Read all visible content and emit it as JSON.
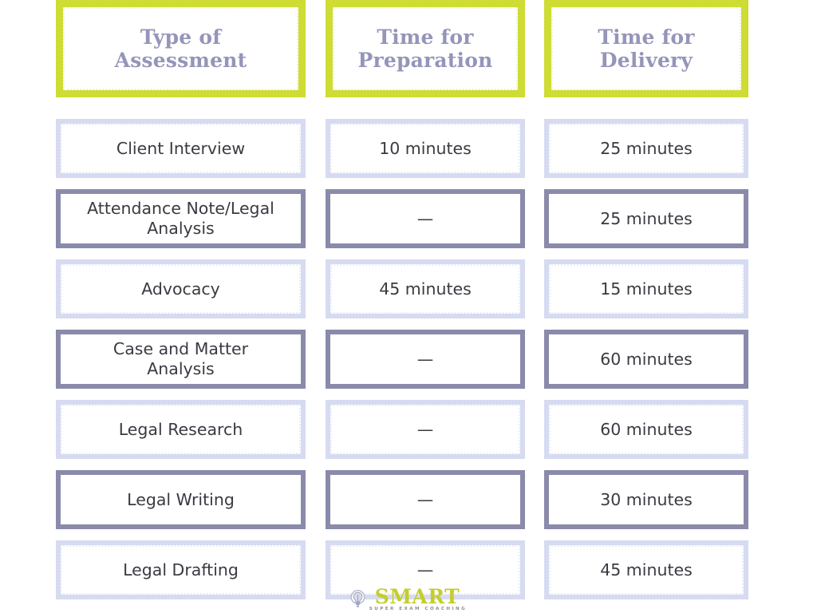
{
  "colors": {
    "header_border": "#cedc34",
    "header_text": "#9595ba",
    "row_border_light": "#d6dbf1",
    "row_border_dark": "#8a8aab",
    "body_text": "#3a3a42",
    "logo_green": "#c3ce2b",
    "logo_bulb": "#b9bcd4",
    "background": "#ffffff"
  },
  "table": {
    "headers": [
      "Type of\nAssessment",
      "Time for\nPreparation",
      "Time for\nDelivery"
    ],
    "header_lines": [
      [
        "Type of",
        "Assessment"
      ],
      [
        "Time for",
        "Preparation"
      ],
      [
        "Time for",
        "Delivery"
      ]
    ],
    "rows": [
      {
        "style": "light",
        "assessment": "Client Interview",
        "assessment_lines": [
          "Client Interview"
        ],
        "preparation": "10 minutes",
        "delivery": "25 minutes"
      },
      {
        "style": "dark",
        "assessment": "Attendance Note/Legal Analysis",
        "assessment_lines": [
          "Attendance Note/Legal",
          "Analysis"
        ],
        "preparation": "—",
        "delivery": "25 minutes"
      },
      {
        "style": "light",
        "assessment": "Advocacy",
        "assessment_lines": [
          "Advocacy"
        ],
        "preparation": "45 minutes",
        "delivery": "15 minutes"
      },
      {
        "style": "dark",
        "assessment": "Case and Matter Analysis",
        "assessment_lines": [
          "Case and Matter",
          "Analysis"
        ],
        "preparation": "—",
        "delivery": "60 minutes"
      },
      {
        "style": "light",
        "assessment": "Legal Research",
        "assessment_lines": [
          "Legal Research"
        ],
        "preparation": "—",
        "delivery": "60 minutes"
      },
      {
        "style": "dark",
        "assessment": "Legal Writing",
        "assessment_lines": [
          "Legal Writing"
        ],
        "preparation": "—",
        "delivery": "30 minutes"
      },
      {
        "style": "light",
        "assessment": "Legal Drafting",
        "assessment_lines": [
          "Legal Drafting"
        ],
        "preparation": "—",
        "delivery": "45 minutes"
      }
    ]
  },
  "logo": {
    "icon": "lightbulb-icon",
    "word": "SMART",
    "tagline": "SUPER EXAM COACHING"
  }
}
